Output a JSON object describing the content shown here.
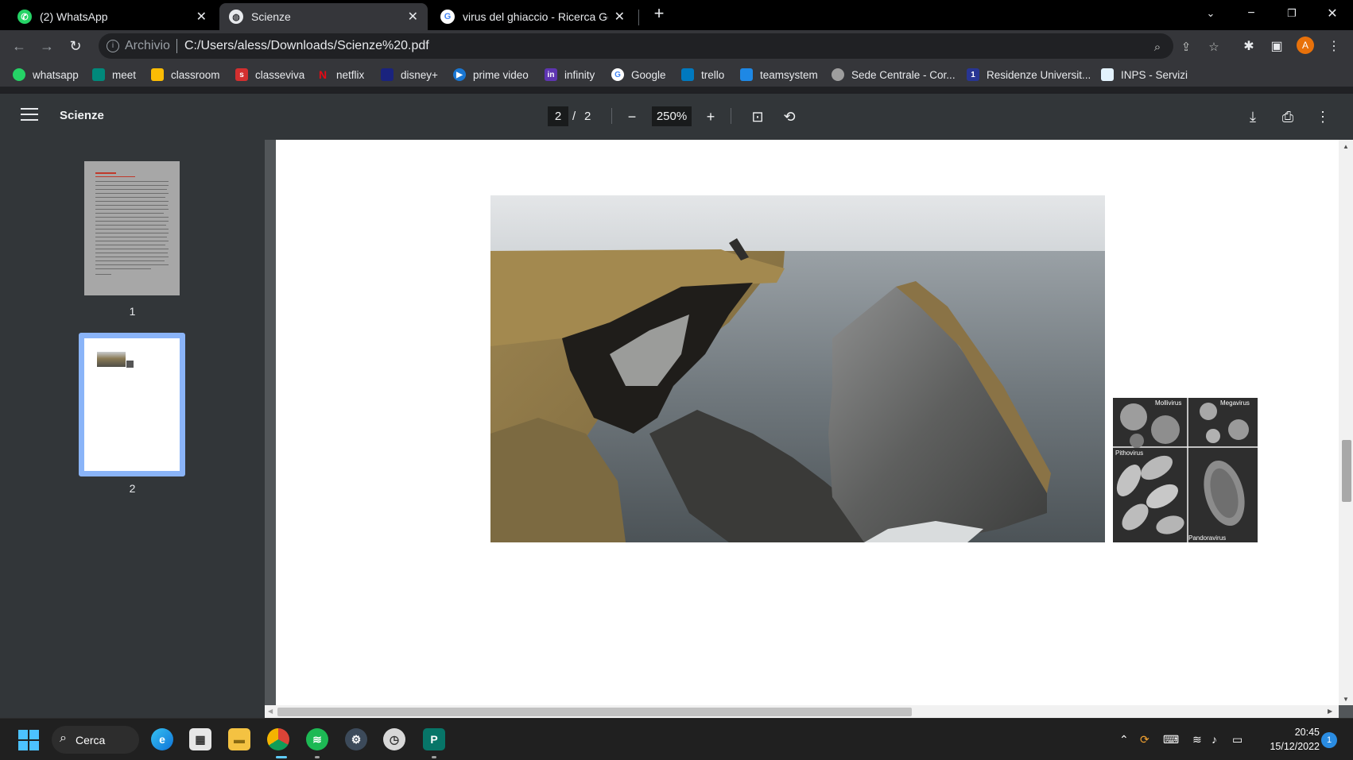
{
  "tabs": [
    {
      "title": "(2) WhatsApp",
      "favicon": "whatsapp-icon"
    },
    {
      "title": "Scienze",
      "favicon": "globe-icon",
      "active": true
    },
    {
      "title": "virus del ghiaccio - Ricerca Goog",
      "favicon": "google-icon"
    }
  ],
  "address": {
    "chip": "Archivio",
    "url": "C:/Users/aless/Downloads/Scienze%20.pdf"
  },
  "profile_initial": "A",
  "bookmarks": [
    "whatsapp",
    "meet",
    "classroom",
    "classeviva",
    "netflix",
    "disney+",
    "prime video",
    "infinity",
    "Google",
    "trello",
    "teamsystem",
    "Sede Centrale - Cor...",
    "Residenze Universit...",
    "INPS - Servizi"
  ],
  "pdf": {
    "title": "Scienze",
    "current_page": "2",
    "separator": "/",
    "total_pages": "2",
    "zoom": "250%",
    "thumbnails": [
      "1",
      "2"
    ]
  },
  "figure_labels": {
    "mollivirus": "Mollivirus",
    "megavirus": "Megavirus",
    "pithovirus": "Pithovirus",
    "pandoravirus": "Pandoravirus"
  },
  "taskbar": {
    "search_label": "Cerca",
    "time": "20:45",
    "date": "15/12/2022",
    "notifications": "1"
  },
  "colors": {
    "chrome_dark": "#202124",
    "toolbar": "#35363a",
    "pdf_bar": "#323639",
    "viewer_bg": "#525659",
    "selected_thumb": "#8ab4f8",
    "profile": "#e8710a"
  }
}
